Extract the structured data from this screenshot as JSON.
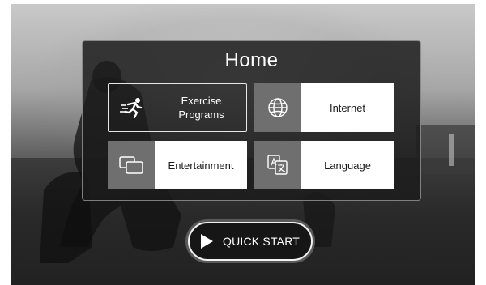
{
  "home": {
    "title": "Home",
    "tiles": [
      {
        "label": "Exercise\nPrograms",
        "icon": "running-person-icon",
        "selected": true
      },
      {
        "label": "Internet",
        "icon": "globe-icon",
        "selected": false
      },
      {
        "label": "Entertainment",
        "icon": "screens-icon",
        "selected": false
      },
      {
        "label": "Language",
        "icon": "translate-icon",
        "selected": false
      }
    ],
    "quick_start_label": "QUICK START"
  },
  "colors": {
    "panel_bg": "#1c1c1c",
    "tile_icon_bg": "#6f6f6f",
    "tile_label_bg": "#ffffff",
    "text_light": "#ffffff"
  }
}
